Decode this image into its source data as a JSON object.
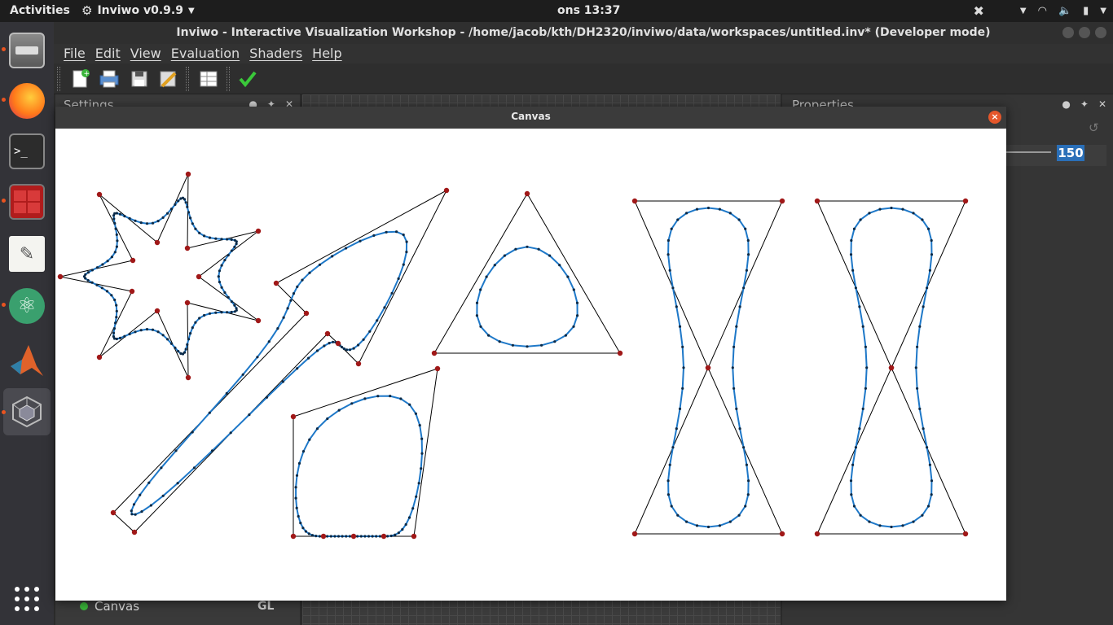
{
  "topbar": {
    "activities": "Activities",
    "app_name": "Inviwo v0.9.9",
    "clock": "ons 13:37"
  },
  "window": {
    "title": "Inviwo - Interactive Visualization Workshop - /home/jacob/kth/DH2320/inviwo/data/workspaces/untitled.inv* (Developer mode)"
  },
  "menu": [
    "File",
    "Edit",
    "View",
    "Evaluation",
    "Shaders",
    "Help"
  ],
  "docks": {
    "settings_title": "Settings",
    "properties_title": "Properties",
    "property_value": "150",
    "processor_name": "Canvas",
    "processor_tag": "GL"
  },
  "canvas": {
    "title": "Canvas",
    "close_label": "×"
  },
  "colors": {
    "control_point": "#a01818",
    "curve": "#1e78c8",
    "curve_dot": "#0a2a48",
    "polygon": "#000000"
  },
  "dock_icons": [
    "files-icon",
    "firefox-icon",
    "terminal-icon",
    "terminator-icon",
    "text-editor-icon",
    "atom-icon",
    "matlab-icon",
    "inviwo-icon"
  ]
}
